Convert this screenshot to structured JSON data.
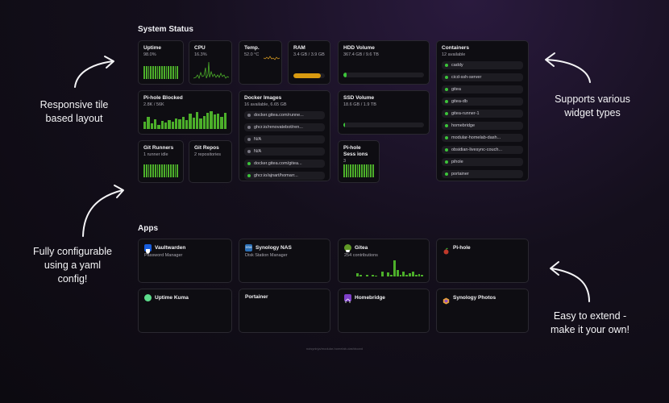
{
  "status": {
    "title": "System Status",
    "uptime": {
      "label": "Uptime",
      "value": "98.0%"
    },
    "cpu": {
      "label": "CPU",
      "value": "16.3%"
    },
    "temp": {
      "label": "Temp.",
      "value": "52.0 °C"
    },
    "ram": {
      "label": "RAM",
      "value": "3.4 GB / 3.9 GB",
      "fraction": 0.87,
      "color": "#d99a10"
    },
    "hdd": {
      "label": "HDD Volume",
      "value": "367.4 GB / 9.6 TB",
      "fraction": 0.04,
      "color": "#3cc43a"
    },
    "ssd": {
      "label": "SSD Volume",
      "value": "18.6 GB / 1.9 TB",
      "fraction": 0.01,
      "color": "#3cc43a"
    },
    "pihole_blocked": {
      "label": "Pi-hole Blocked",
      "value": "2.8K / 56K"
    },
    "docker_images": {
      "label": "Docker Images",
      "value": "16 available, 6.65 GB",
      "items": [
        {
          "name": "docker.gitea.com/runne...",
          "status": "gray"
        },
        {
          "name": "ghcr.io/renovatebot/ren...",
          "status": "gray"
        },
        {
          "name": "N/A",
          "status": "gray"
        },
        {
          "name": "N/A",
          "status": "gray"
        },
        {
          "name": "docker.gitea.com/gitea...",
          "status": "green"
        },
        {
          "name": "ghcr.io/ajnart/homarr...",
          "status": "green"
        }
      ]
    },
    "containers": {
      "label": "Containers",
      "value": "12 available",
      "items": [
        "caddy",
        "cicd-ssh-server",
        "gitea",
        "gitea-db",
        "gitea-runner-1",
        "homebridge",
        "modular-homelab-dash...",
        "obsidian-livesync-couch...",
        "pihole",
        "portainer"
      ]
    },
    "git_runners": {
      "label": "Git Runners",
      "value": "1 runner idle"
    },
    "git_repos": {
      "label": "Git Repos",
      "value": "2 repositories"
    },
    "pihole_sessions": {
      "label": "Pi-hole Sess ions",
      "value": "3"
    }
  },
  "apps": {
    "title": "Apps",
    "items": [
      {
        "name": "Vaultwarden",
        "desc": "Password Manager",
        "icon": "vaultwarden-icon",
        "color": "#175ddc"
      },
      {
        "name": "Synology NAS",
        "desc": "Disk Station Manager",
        "icon": "synology-icon",
        "color": "#2a6fb5"
      },
      {
        "name": "Gitea",
        "desc": "254 contributions",
        "icon": "gitea-icon",
        "color": "#609926"
      },
      {
        "name": "Pi-hole",
        "desc": "",
        "icon": "pihole-icon",
        "color": "#c0392b"
      },
      {
        "name": "Uptime Kuma",
        "desc": "",
        "icon": "uptime-kuma-icon",
        "color": "#5cdd8b"
      },
      {
        "name": "Portainer",
        "desc": "",
        "icon": "",
        "color": ""
      },
      {
        "name": "Homebridge",
        "desc": "",
        "icon": "homebridge-icon",
        "color": "#7d3fc8"
      },
      {
        "name": "Synology Photos",
        "desc": "",
        "icon": "synology-photos-icon",
        "color": "#e9a23b"
      }
    ]
  },
  "captions": {
    "responsive": "Responsive tile based layout",
    "supports": "Supports various widget types",
    "configurable": "Fully configurable using a yaml config!",
    "extend": "Easy to extend - make it your own!"
  },
  "footer": "noisyninja/modular-homelab-dashboard"
}
